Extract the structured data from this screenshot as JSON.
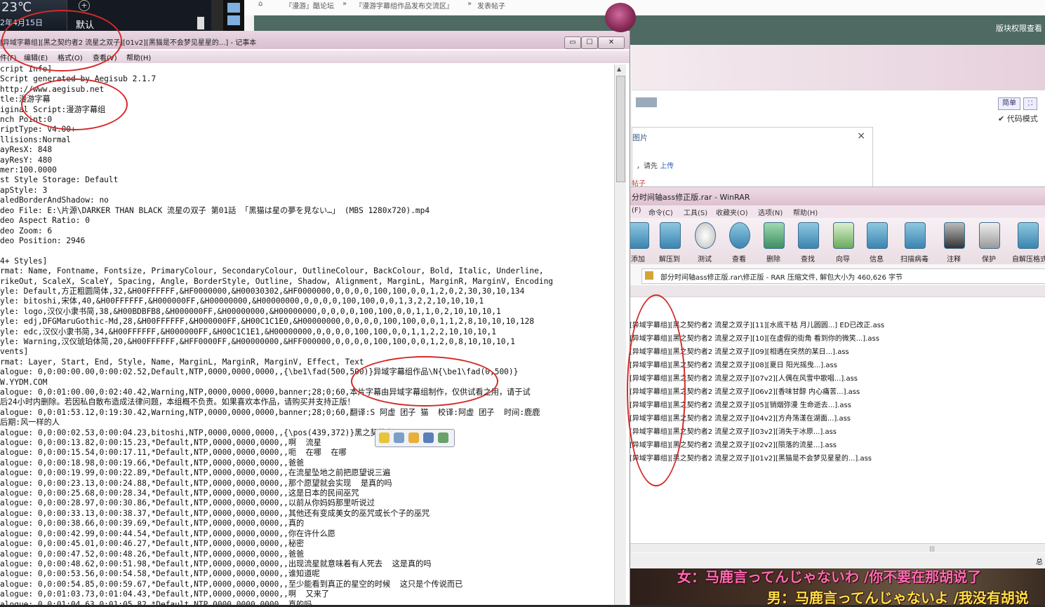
{
  "desktop": {
    "weather": {
      "temp": "23℃",
      "date": "2年4月15日"
    },
    "launcher": {
      "default_label": "默认",
      "add": "+"
    }
  },
  "forum": {
    "crumbs": [
      "『漫游』酷论坛",
      "»",
      "『漫游字幕组作品发布交流区』",
      "»",
      "发表帖子"
    ],
    "permission_link": "版块权限查看",
    "editor": {
      "simple_btn": "简单",
      "fullscreen_btn": "⛶",
      "code_mode": "代码模式",
      "upload_tab": "图片",
      "close": "×",
      "tip_prefix": "，请先 ",
      "tip_link": "上传",
      "sticky": "帖子"
    }
  },
  "winrar": {
    "title": "分时间轴ass修正版.rar - WinRAR",
    "menu": [
      "(F)",
      "命令(C)",
      "工具(S)",
      "收藏夹(O)",
      "选项(N)",
      "帮助(H)"
    ],
    "tools": [
      "添加",
      "解压到",
      "测试",
      "查看",
      "删除",
      "查找",
      "向导",
      "信息",
      "扫描病毒",
      "注释",
      "保护",
      "自解压格式"
    ],
    "path": "部分时间轴ass修正版.rar\\修正版 - RAR 压缩文件, 解包大小为 460,626 字节",
    "files": [
      "[异域字幕组][黑之契约者2 流星之双子][11][水底干枯 月儿圆圆...] ED已改正.ass",
      "[异域字幕组][黑之契约者2 流星之双子][10][在虚假的街角 看到你的微笑...].ass",
      "[异域字幕组][黑之契约者2 流星之双子][09][相遇在突然的某日...].ass",
      "[异域字幕组][黑之契约者2 流星之双子][08][夏日 阳光摇曳...].ass",
      "[异域字幕组][黑之契约者2 流星之双子][07v2][人偶在风雪中歌唱...].ass",
      "[异域字幕组][黑之契约者2 流星之双子][06v2][香味甘醇 内心痛苦...].ass",
      "[异域字幕组][黑之契约者2 流星之双子][05][销烟弥漫 生命逝去...].ass",
      "[异域字幕组][黑之契约者2 流星之双子][04v2][方舟荡漾在湖面...].ass",
      "[异域字幕组][黑之契约者2 流星之双子][03v2][消失于冰原...].ass",
      "[异域字幕组][黑之契约者2 流星之双子][02v2][陨落的流星...].ass",
      "[异域字幕组][黑之契约者2 流星之双子][01v2][黑猫是不会梦见星星的...].ass"
    ],
    "status_right": "总"
  },
  "video": {
    "sub_female": "女：马鹿言ってんじゃないわ /你不要在那胡说了",
    "sub_male": "男：马鹿言ってんじゃないよ /我没有胡说"
  },
  "notepad": {
    "title": "[异域字幕组][黑之契约者2 流星之双子][01v2][黑猫是不会梦见星星的...] - 记事本",
    "buttons": {
      "min": "▭",
      "max": "☐",
      "close": "✕"
    },
    "menu": [
      "件(F)",
      "编辑(E)",
      "格式(O)",
      "查看(V)",
      "帮助(H)"
    ],
    "content": "cript Info]\nScript generated by Aegisub 2.1.7\nhttp://www.aegisub.net\ntle:漫游字幕\niginal Script:漫游字幕组\nnch Point:0\nriptType: v4.00+\nllisions:Normal\nayResX: 848\nayResY: 480\nmer:100.0000\nst Style Storage: Default\napStyle: 3\naledBorderAndShadow: no\ndeo File: E:\\片源\\DARKER THAN BLACK 流星の双子 第01話 「黑猫は星の夢を見ない…」 (MBS 1280x720).mp4\ndeo Aspect Ratio: 0\ndeo Zoom: 6\ndeo Position: 2946\n\n4+ Styles]\nrmat: Name, Fontname, Fontsize, PrimaryColour, SecondaryColour, OutlineColour, BackColour, Bold, Italic, Underline,\nrikeOut, ScaleX, ScaleY, Spacing, Angle, BorderStyle, Outline, Shadow, Alignment, MarginL, MarginR, MarginV, Encoding\nyle: Default,方正粗圆简体,32,&H00FFFFFF,&HF0000000,&H00030302,&HF0000000,0,0,0,0,100,100,0,0,1,2,0,2,30,30,10,134\nyle: bitoshi,宋体,40,&H00FFFFFF,&H000000FF,&H00000000,&H00000000,0,0,0,0,100,100,0,0,1,3,2,2,10,10,10,1\nyle: logo,汉仪小隶书简,38,&H00BDBFB8,&H000000FF,&H00000000,&H00000000,0,0,0,0,100,100,0,0,1,1,0,2,10,10,10,1\nyle: edj,DFGMaruGothic-Md,28,&H00FFFFFF,&H000000FF,&H00C1C1E0,&H00000000,0,0,0,0,100,100,0,0,1,1,2,8,10,10,10,128\nyle: edc,汉仪小隶书简,34,&H00FFFFFF,&H000000FF,&H00C1C1E1,&H00000000,0,0,0,0,100,100,0,0,1,1,2,2,10,10,10,1\nyle: Warning,汉仪琥珀体简,20,&H00FFFFFF,&HFF0000FF,&H00000000,&HFF000000,0,0,0,0,100,100,0,0,1,2,0,8,10,10,10,1\nvents]\nrmat: Layer, Start, End, Style, Name, MarginL, MarginR, MarginV, Effect, Text\nalogue: 0,0:00:00.00,0:00:02.52,Default,NTP,0000,0000,0000,,{\\be1\\fad(500,500)}异域字幕组作品\\N{\\be1\\fad(0,500)}\nW.YYDM.COM\nalogue: 0,0:01:00.00,0:02:40.42,Warning,NTP,0000,0000,0000,banner;28;0;60,本片字幕由异域字幕组制作，仅供试看之用，请于试\n后24小时内删除。若因私自散布造成法律问题，本组概不负责。如果喜欢本作品，请购买并支持正版！\nalogue: 0,0:01:53.12,0:19:30.42,Warning,NTP,0000,0000,0000,banner;28;0;60,翻译:S 阿虚 团子 猫  校译:阿虚 团子  时间:鹿鹿\n后期:风一样的人\nalogue: 0,0:00:02.53,0:00:04.23,bitoshi,NTP,0000,0000,0000,,{\\pos(439,372)}黑之契约者\nalogue: 0,0:00:13.82,0:00:15.23,*Default,NTP,0000,0000,0000,,啊  流星\nalogue: 0,0:00:15.54,0:00:17.11,*Default,NTP,0000,0000,0000,,呃  在哪  在哪\nalogue: 0,0:00:18.98,0:00:19.66,*Default,NTP,0000,0000,0000,,爸爸\nalogue: 0,0:00:19.99,0:00:22.89,*Default,NTP,0000,0000,0000,,在流星坠地之前把愿望说三遍\nalogue: 0,0:00:23.13,0:00:24.88,*Default,NTP,0000,0000,0000,,那个愿望就会实现  是真的吗\nalogue: 0,0:00:25.68,0:00:28.34,*Default,NTP,0000,0000,0000,,这是日本的民间巫咒\nalogue: 0,0:00:28.97,0:00:30.86,*Default,NTP,0000,0000,0000,,以前从你妈妈那里听说过\nalogue: 0,0:00:33.13,0:00:38.37,*Default,NTP,0000,0000,0000,,其他还有变成美女的巫咒或长个子的巫咒\nalogue: 0,0:00:38.66,0:00:39.69,*Default,NTP,0000,0000,0000,,真的\nalogue: 0,0:00:42.99,0:00:44.54,*Default,NTP,0000,0000,0000,,你在许什么愿\nalogue: 0,0:00:45.01,0:00:46.27,*Default,NTP,0000,0000,0000,,秘密\nalogue: 0,0:00:47.52,0:00:48.26,*Default,NTP,0000,0000,0000,,爸爸\nalogue: 0,0:00:48.62,0:00:51.98,*Default,NTP,0000,0000,0000,,出现流星就意味着有人死去  这是真的吗\nalogue: 0,0:00:53.56,0:00:54.58,*Default,NTP,0000,0000,0000,,谁知道呢\nalogue: 0,0:00:54.85,0:00:59.67,*Default,NTP,0000,0000,0000,,至少能看到真正的星空的时候  这只是个传说而已\nalogue: 0,0:01:03.73,0:01:04.43,*Default,NTP,0000,0000,0000,,啊  又来了\nalogue: 0,0:01:04.63,0:01:05.82,*Default,NTP,0000,0000,0000,,真的吗"
  }
}
